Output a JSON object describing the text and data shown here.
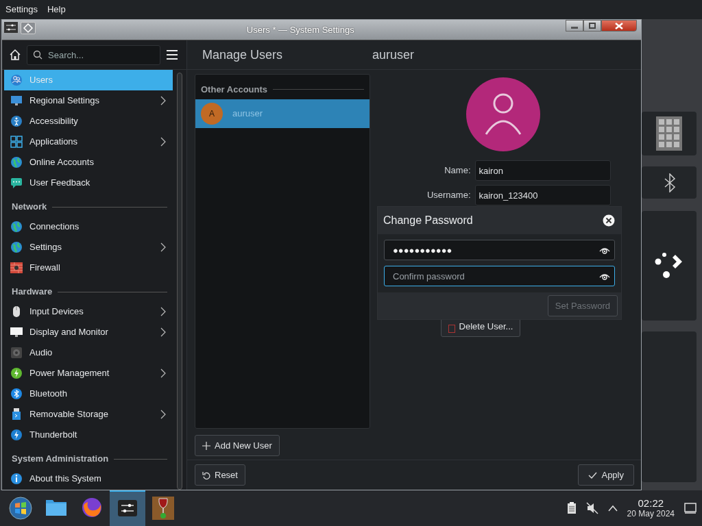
{
  "menubar": [
    {
      "label": "Settings"
    },
    {
      "label": "Help"
    }
  ],
  "window": {
    "title": "Users * — System Settings"
  },
  "sidebar": {
    "search_placeholder": "Search...",
    "groups": [
      {
        "items": [
          {
            "label": "Users",
            "expandable": false,
            "selected": true
          },
          {
            "label": "Regional Settings",
            "expandable": true,
            "selected": false
          },
          {
            "label": "Accessibility",
            "expandable": false,
            "selected": false
          },
          {
            "label": "Applications",
            "expandable": true,
            "selected": false
          },
          {
            "label": "Online Accounts",
            "expandable": false,
            "selected": false
          },
          {
            "label": "User Feedback",
            "expandable": false,
            "selected": false
          }
        ]
      },
      {
        "heading": "Network",
        "items": [
          {
            "label": "Connections",
            "expandable": false,
            "selected": false
          },
          {
            "label": "Settings",
            "expandable": true,
            "selected": false
          },
          {
            "label": "Firewall",
            "expandable": false,
            "selected": false
          }
        ]
      },
      {
        "heading": "Hardware",
        "items": [
          {
            "label": "Input Devices",
            "expandable": true,
            "selected": false
          },
          {
            "label": "Display and Monitor",
            "expandable": true,
            "selected": false
          },
          {
            "label": "Audio",
            "expandable": false,
            "selected": false
          },
          {
            "label": "Power Management",
            "expandable": true,
            "selected": false
          },
          {
            "label": "Bluetooth",
            "expandable": false,
            "selected": false
          },
          {
            "label": "Removable Storage",
            "expandable": true,
            "selected": false
          },
          {
            "label": "Thunderbolt",
            "expandable": false,
            "selected": false
          }
        ]
      },
      {
        "heading": "System Administration",
        "items": [
          {
            "label": "About this System",
            "expandable": false,
            "selected": false
          }
        ]
      }
    ]
  },
  "page": {
    "title": "Manage Users",
    "detail_title": "auruser"
  },
  "accounts": {
    "heading": "Other Accounts",
    "users": [
      {
        "initial": "A",
        "name": "auruser",
        "selected": true
      }
    ],
    "add_button": "Add New User"
  },
  "details": {
    "fields": [
      {
        "label": "Name:",
        "value": "kairon"
      },
      {
        "label": "Username:",
        "value": "kairon_123400"
      }
    ],
    "delete_button": "Delete User..."
  },
  "change_password": {
    "title": "Change Password",
    "password": "●●●●●●●●●●●",
    "confirm_placeholder": "Confirm password",
    "confirm_focused": true,
    "set_button": "Set Password",
    "set_disabled": true
  },
  "footer": {
    "reset": "Reset",
    "apply": "Apply"
  },
  "taskbar": {
    "apps": [
      {
        "active": false
      },
      {
        "active": false
      },
      {
        "active": true
      },
      {
        "active": false
      }
    ],
    "time": "02:22",
    "date": "20 May 2024"
  }
}
